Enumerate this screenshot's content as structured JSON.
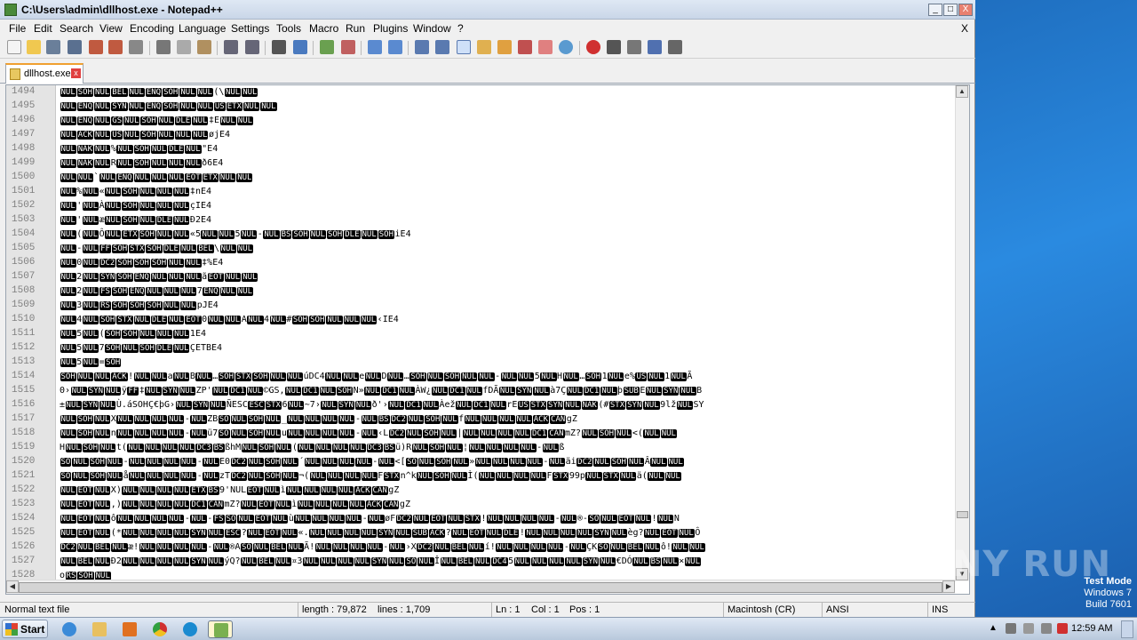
{
  "window": {
    "title": "C:\\Users\\admin\\dllhost.exe - Notepad++",
    "min": "_",
    "max": "□",
    "close": "X"
  },
  "menu": {
    "items": [
      "File",
      "Edit",
      "Search",
      "View",
      "Encoding",
      "Language",
      "Settings",
      "Tools",
      "Macro",
      "Run",
      "Plugins",
      "Window",
      "?"
    ],
    "close": "X"
  },
  "tab": {
    "label": "dllhost.exe",
    "close": "x"
  },
  "editor": {
    "line_numbers": [
      "1494",
      "1495",
      "1496",
      "1497",
      "1498",
      "1499",
      "1500",
      "1501",
      "1502",
      "1503",
      "1504",
      "1505",
      "1506",
      "1507",
      "1508",
      "1509",
      "1510",
      "1511",
      "1512",
      "1513",
      "1514",
      "1515",
      "1516",
      "1517",
      "1518",
      "1519",
      "1520",
      "1521",
      "1522",
      "1523",
      "1524",
      "1525",
      "1526",
      "1527",
      "1528"
    ],
    "lines": [
      "NUL SOH NUL BEL NUL ENQ SOH NUL NUL (\\ NUL NUL",
      "NUL ENQ NUL SYN NUL ENQ SOH NUL NUL US ETX NUL NUL",
      "NUL ENQ NUL GS NUL SOH NUL DLE NUL ‡E NUL NUL",
      "NUL ACK NUL US NUL SOH NUL NUL NUL øjE4",
      "NUL NAK NUL % NUL SOH NUL DLE NUL \"E4",
      "NUL NAK NUL R NUL SOH NUL NUL NUL ð6E4",
      "NUL NUL ` NUL ENQ NUL NUL NUL EOT ETX NUL NUL",
      "NUL % NUL « NUL SOH NUL NUL NUL ‡nE4",
      "NUL ' NUL À NUL SOH NUL NUL NUL çIE4",
      "NUL ' NUL æ NUL SOH NUL DLE NUL Ð2E4",
      "NUL ( NUL Ô NUL ETX SOH NUL NUL «5 NUL NUL 5 NUL - NUL BS SOH NUL SOH DLE NUL SOH iE4",
      "NUL - NUL FF SOH STX SOH DLE NUL BEL \\ NUL NUL",
      "NUL 0 NUL DC2 SOH SOH SOH NUL NUL ‡%E4",
      "NUL 2 NUL SYN SOH ENQ NUL NUL NUL ã EOT NUL NUL",
      "NUL 2 NUL FS SOH ENQ NUL NUL NUL 7 ENQ NUL NUL",
      "NUL 3 NUL RS SOH SOH SOH NUL NUL pJE4",
      "NUL 4 NUL SOH STX NUL DLE NUL EOT 0 NUL NUL A NUL 4 NUL # SOH SOH NUL NUL NUL ‹ IE4",
      "NUL 5 NUL ( SOH SOH NUL NUL NUL 1E4",
      "NUL 5 NUL 7 SOH NUL SOH DLE NUL ÇETBE4",
      "NUL 5 NUL = SOH",
      "SOH NUL NUL ACK ! NUL NUL a NUL B NUL … SOH STX SOH NUL NUL úDC4 NUL NUL e NUL D NUL … SOH NUL SOH NUL NUL - NUL NUL 5 NUL H NUL … SOH 1 NUL e % US NUL 1 NUL Ã",
      "0 › NUL SYN NUL ÿ FF ‡ NUL SYN NUL ZP ' NUL DC1 NUL ©GS, NUL DC1 NUL SOH N » NUL DC1 NUL À W¿ NUL DC1 NUL fDÃ NUL SYN NUL à7Ç NUL DC1 NUL þ SUB E NUL SYN NUL B",
      "± NUL SYN NUL Ù.áSOHÇ€þG› NUL SYN NUL ÑESC ESC STX 6 NUL ~7› NUL SYN NUL ð' › NUL DC1 NUL Àež NUL DC1 NUL rE US STX SYN NUL NAK (# STX SYN NUL 9lž NUL SY",
      "NUL SOH NUL X NUL NUL NUL NUL - NUL ZB SO NUL SOH NUL _ NUL NUL NUL NUL - NUL BS DC2 NUL SOH NUL f NUL NUL NUL NUL ACK CAN gZ",
      "NUL SOH NUL n NUL NUL NUL NUL - NUL ü7 SO NUL SOH NUL u NUL NUL NUL NUL - NUL ‹ L DC2 NUL SOH NUL | NUL NUL NUL NUL DC1 CAN mZ? NUL SOH NUL < ( NUL NUL",
      "H NUL SOH NUL t ( NUL NUL NUL NUL DC3 BS ßhM NUL SOH NUL ( NUL NUL NUL NUL DC3 BS ü) R NUL SOH NUL ¦ NUL NUL NUL NUL - NUL ß",
      "SO NUL SOH NUL - NUL NUL NUL NUL - NUL E0 DC2 NUL SOH NUL ´ NUL NUL NUL NUL - NUL <[ SO NUL SOH NUL » NUL NUL NUL NUL - NUL äi DC2 NUL SOH NUL Â NUL NUL",
      "SO NUL SOH NUL å NUL NUL NUL NUL - NUL zT DC2 NUL SOH NUL ¬ ( NUL NUL NUL NUL F STX n^k NUL SOH NUL Ì ( NUL NUL NUL NUL F STX 99p NUL STX NUL ä ( NUL NUL",
      "NUL EOT NUL X) NUL NUL NUL NUL ETX BS 9 'NUL EOT NUL ì NUL NUL NUL NUL ACK CAN gZ",
      "NUL EOT NUL ,) NUL NUL NUL NUL DC1 CAN mZ? NUL EOT NUL ì NUL NUL NUL NUL ACK CAN gZ",
      "NUL EOT NUL ô NUL NUL NUL NUL - NUL - FS SO NUL EOT NUL ù NUL NUL NUL NUL - NUL ø F DC2 NUL EOT NUL STX ! NUL NUL NUL NUL - NUL ®- SO NUL EOT NUL ! NUL N",
      "NUL EOT NUL ( * NUL NUL NUL NUL SYN NUL ESC ? NUL EOT NUL « . NUL NUL NUL NUL SYN NUL SUB ACK ? NUL EOT NUL DLE ! NUL NUL NUL NUL SYN NUL èg? NUL EOT NUL Ô",
      "DC2 NUL BEL NUL æ ! NUL NUL NUL NUL - NUL ®A SO NUL BEL NUL Ã ! NUL NUL NUL NUL - NUL › X DC2 NUL BEL NUL í ! NUL NUL NUL NUL - NUL ÇK SO NUL BEL NUL ô ! NUL NUL",
      "NUL BEL NUL Ð2 NUL NUL NUL NUL SYN NUL ýQ? NUL BEL NUL ¤3 NUL NUL NUL NUL SYN NUL SO NUL Î NUL BEL NUL DC4 5 NUL NUL NUL NUL SYN NUL €DÓ NUL BS NUL × NUL",
      "o RS SOH NUL"
    ]
  },
  "status": {
    "type": "Normal text file",
    "length": "length : 79,872",
    "lines": "lines : 1,709",
    "ln": "Ln : 1",
    "col": "Col : 1",
    "pos": "Pos : 1",
    "eol": "Macintosh (CR)",
    "encoding": "ANSI",
    "mode": "INS"
  },
  "desktop": {
    "watermark": "ANY RUN",
    "test_mode": [
      "Test Mode",
      "Windows 7",
      "Build 7601"
    ]
  },
  "taskbar": {
    "start": "Start",
    "clock": "12:59 AM"
  }
}
